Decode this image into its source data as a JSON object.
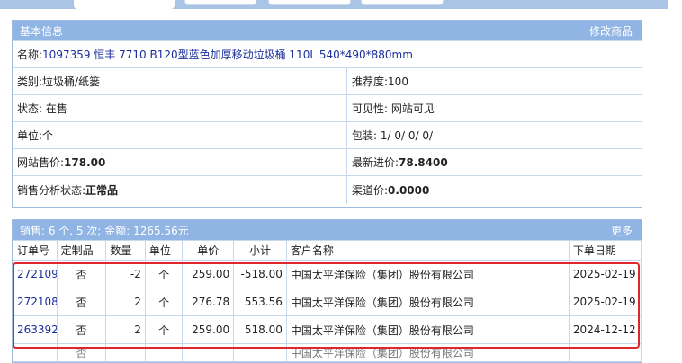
{
  "info": {
    "header_title": "基本信息",
    "edit_link": "修改商品",
    "name": {
      "label": "名称:",
      "value": "1097359 恒丰 7710 B120型蓝色加厚移动垃圾桶 110L 540*490*880mm"
    },
    "category": {
      "label": "类别:",
      "value": "垃圾桶/纸篓"
    },
    "recommend": {
      "label": "推荐度:",
      "value": "100"
    },
    "status": {
      "label": "状态:",
      "value": "在售"
    },
    "visibility": {
      "label": "可见性:",
      "value": "网站可见"
    },
    "unit": {
      "label": "单位:",
      "value": "个"
    },
    "packing": {
      "label": "包装:",
      "value": "1/ 0/ 0/ 0/"
    },
    "web_price": {
      "label": "网站售价:",
      "value": "178.00"
    },
    "latest_cost": {
      "label": "最新进价:",
      "value": "78.8400"
    },
    "sales_status": {
      "label": "销售分析状态:",
      "value": "正常品"
    },
    "channel_price": {
      "label": "渠道价:",
      "value": "0.0000"
    }
  },
  "sales": {
    "summary": "销售:  6 个, 5 次; 金额: 1265.56元",
    "more_link": "更多",
    "columns": [
      "订单号",
      "定制品",
      "数量",
      "单位",
      "单价",
      "小计",
      "客户名称",
      "下单日期"
    ],
    "rows": [
      {
        "order": "272109",
        "custom": "否",
        "qty": "-2",
        "unit": "个",
        "price": "259.00",
        "subtotal": "-518.00",
        "customer": "中国太平洋保险（集团）股份有限公司",
        "date": "2025-02-19"
      },
      {
        "order": "272108",
        "custom": "否",
        "qty": "2",
        "unit": "个",
        "price": "276.78",
        "subtotal": "553.56",
        "customer": "中国太平洋保险（集团）股份有限公司",
        "date": "2025-02-19"
      },
      {
        "order": "263392",
        "custom": "否",
        "qty": "2",
        "unit": "个",
        "price": "259.00",
        "subtotal": "518.00",
        "customer": "中国太平洋保险（集团）股份有限公司",
        "date": "2024-12-12"
      },
      {
        "order": "",
        "custom": "否",
        "qty": "",
        "unit": "",
        "price": "",
        "subtotal": "",
        "customer": "中国太平洋保险（集团）股份有限公司",
        "date": ""
      }
    ]
  },
  "colors": {
    "header_bg": "#90b4e3",
    "highlight": "#e0252b",
    "link": "#1b2f9c"
  }
}
